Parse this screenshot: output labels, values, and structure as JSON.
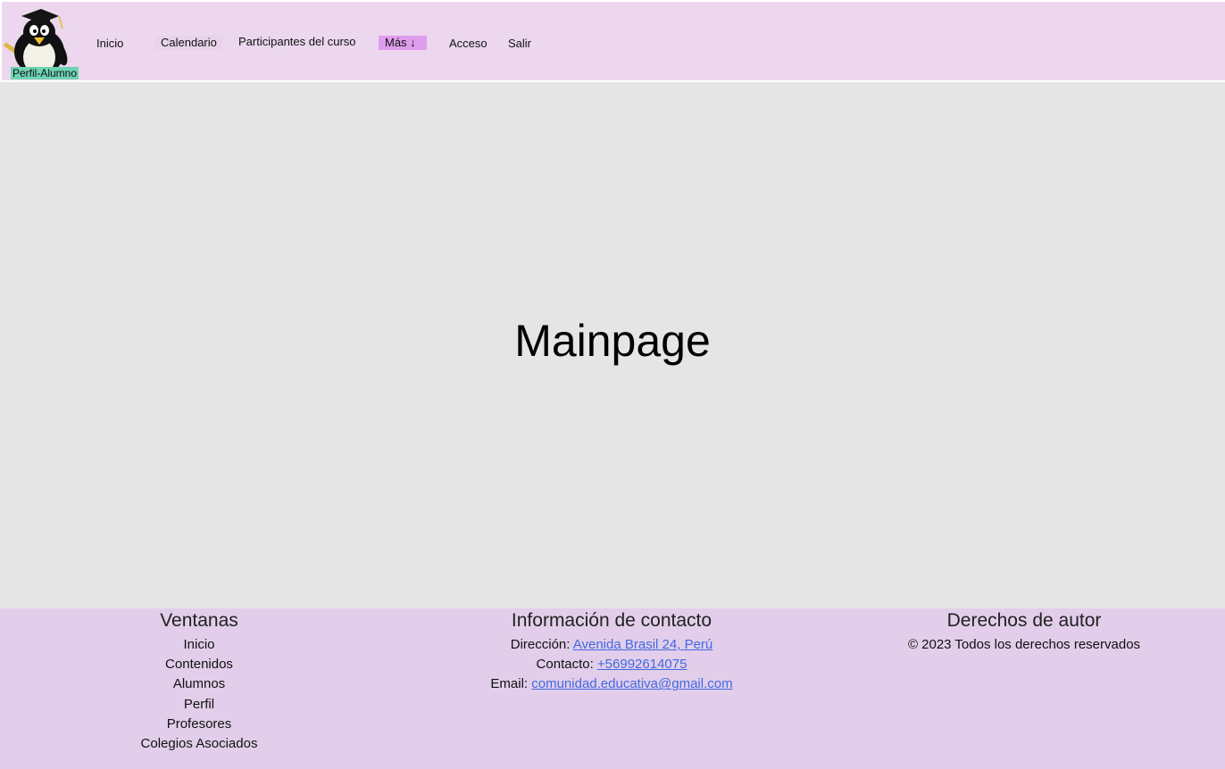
{
  "header": {
    "profile_badge": "Perfil-Alumno",
    "nav": {
      "inicio": "Inicio",
      "calendario": "Calendario",
      "participantes": "Participantes del curso",
      "mas": "Más ↓",
      "acceso": "Acceso",
      "salir": "Salir"
    }
  },
  "main": {
    "title": "Mainpage"
  },
  "footer": {
    "ventanas": {
      "heading": "Ventanas",
      "items": [
        "Inicio",
        "Contenidos",
        "Alumnos",
        "Perfil",
        "Profesores",
        "Colegios Asociados"
      ]
    },
    "contacto": {
      "heading": "Información de contacto",
      "direccion_label": "Dirección: ",
      "direccion_value": "Avenida Brasil 24, Perú",
      "contacto_label": "Contacto: ",
      "contacto_value": "+56992614075",
      "email_label": "Email: ",
      "email_value": "comunidad.educativa@gmail.com"
    },
    "derechos": {
      "heading": "Derechos de autor",
      "text": "© 2023 Todos los derechos reservados"
    }
  },
  "colors": {
    "header_bg": "#ecd7ee",
    "main_bg": "#e5e5e5",
    "footer_bg": "#e2ceea",
    "badge_bg": "#6ed3b3",
    "mas_bg": "#df9ded",
    "link": "#4169e1"
  },
  "icons": {
    "logo": "graduate-penguin-logo"
  }
}
